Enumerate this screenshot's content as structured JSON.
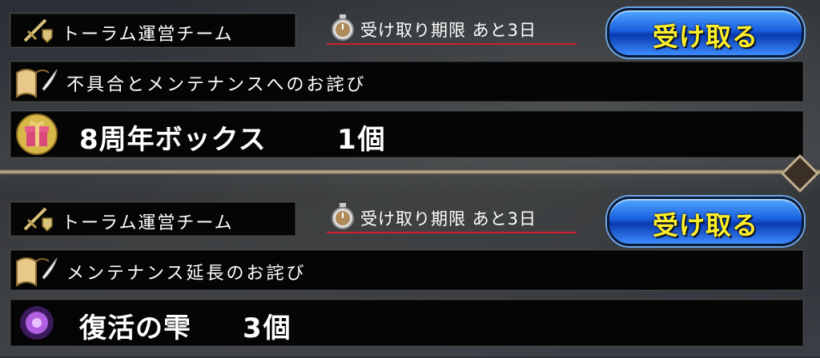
{
  "cards": [
    {
      "sender": "トーラム運営チーム",
      "deadline": "受け取り期限  あと3日",
      "claim_label": "受け取る",
      "title": "不具合とメンテナンスへのお詫び",
      "item": {
        "name": "8周年ボックス",
        "quantity": "1個",
        "icon": "gift-icon"
      }
    },
    {
      "sender": "トーラム運営チーム",
      "deadline": "受け取り期限  あと3日",
      "claim_label": "受け取る",
      "title": "メンテナンス延長のお詫び",
      "item": {
        "name": "復活の雫",
        "quantity": "3個",
        "icon": "orb-icon"
      }
    }
  ],
  "colors": {
    "claim_text": "#ffef2a",
    "deadline_underline": "#d0202a",
    "button_blue": "#1a5fe0"
  }
}
